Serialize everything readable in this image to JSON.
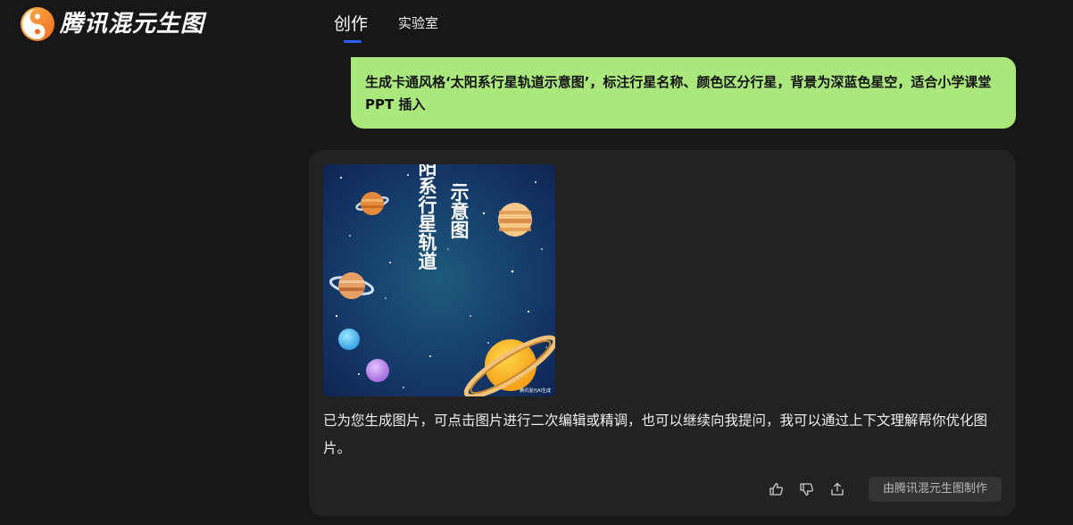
{
  "header": {
    "app_name": "腾讯混元生图",
    "logo_icon": "hunyuan-logo",
    "tabs": [
      {
        "label": "创作",
        "active": true
      },
      {
        "label": "实验室",
        "active": false
      }
    ],
    "accent_color": "#2b62ff"
  },
  "chat": {
    "user_message": "生成卡通风格‘太阳系行星轨道示意图’，标注行星名称、颜色区分行星，背景为深蓝色星空，适合小学课堂 PPT 插入",
    "user_bubble_color": "#aae87d",
    "reply": {
      "image": {
        "title_col1": "太阳系行星轨道",
        "title_col2": "示意图",
        "watermark": "腾讯混元AI生成"
      },
      "text": "已为您生成图片，可点击图片进行二次编辑或精调，也可以继续向我提问，我可以通过上下文理解帮你优化图片。",
      "actions": {
        "like_icon": "thumbs-up-icon",
        "dislike_icon": "thumbs-down-icon",
        "share_icon": "share-icon",
        "made_by_label": "由腾讯混元生图制作"
      }
    }
  }
}
